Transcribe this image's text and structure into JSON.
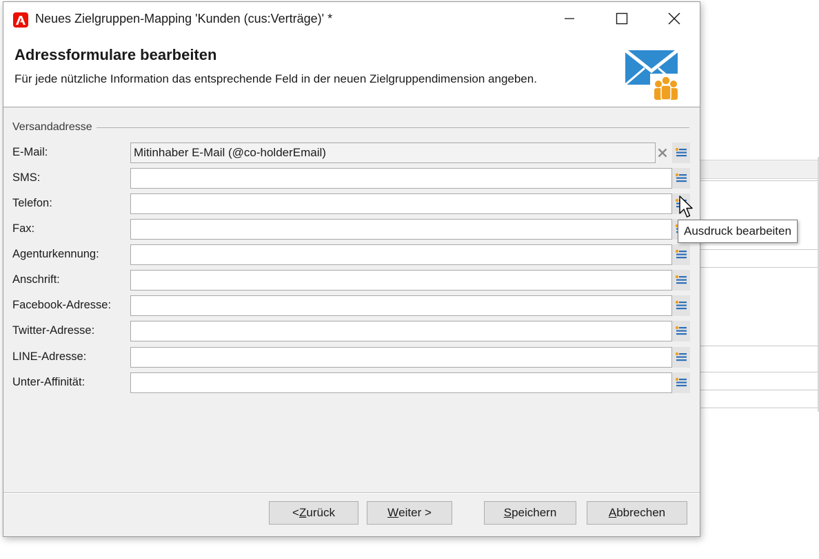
{
  "window": {
    "title": "Neues Zielgruppen-Mapping 'Kunden (cus:Verträge)' *",
    "app_logo_letter": "A",
    "app_logo_color": "#eb1000",
    "controls": [
      "minimize-icon",
      "maximize-icon",
      "close-icon"
    ]
  },
  "header": {
    "title": "Adressformulare bearbeiten",
    "subtitle": "Für jede nützliche Information das entsprechende Feld in der neuen Zielgruppendimension angeben.",
    "icon": "mail-audience-icon",
    "icon_colors": {
      "envelope": "#2e8bd0",
      "people": "#f0a020"
    }
  },
  "group": {
    "label": "Versandadresse"
  },
  "fields": [
    {
      "label": "E-Mail:",
      "value": "Mitinhaber E-Mail (@co-holderEmail)",
      "clearable": true
    },
    {
      "label": "SMS:",
      "value": ""
    },
    {
      "label": "Telefon:",
      "value": ""
    },
    {
      "label": "Fax:",
      "value": ""
    },
    {
      "label": "Agenturkennung:",
      "value": ""
    },
    {
      "label": "Anschrift:",
      "value": ""
    },
    {
      "label": "Facebook-Adresse:",
      "value": ""
    },
    {
      "label": "Twitter-Adresse:",
      "value": ""
    },
    {
      "label": "LINE-Adresse:",
      "value": ""
    },
    {
      "label": "Unter-Affinität:",
      "value": ""
    }
  ],
  "tooltip": {
    "text": "Ausdruck bearbeiten"
  },
  "footer": {
    "back": {
      "label": "< Zurück",
      "mnemonic": "Z"
    },
    "next": {
      "label": "Weiter >",
      "mnemonic": "W"
    },
    "save": {
      "label": "Speichern",
      "mnemonic": "S"
    },
    "cancel": {
      "label": "Abbrechen",
      "mnemonic": "A"
    }
  }
}
